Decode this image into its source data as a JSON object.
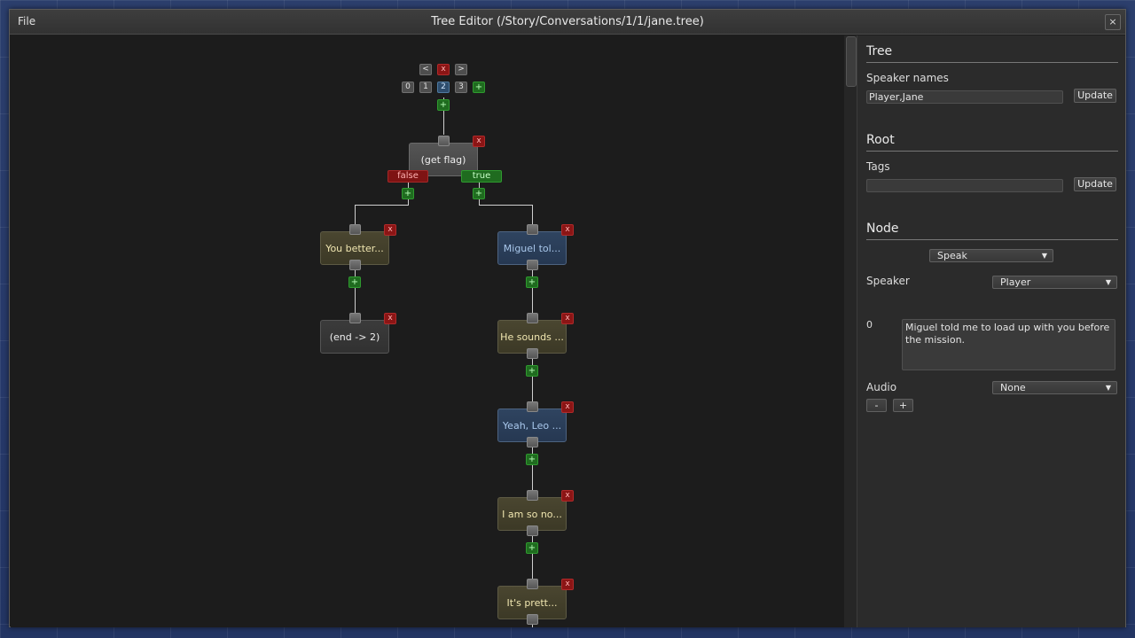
{
  "window": {
    "title": "Tree Editor (/Story/Conversations/1/1/jane.tree)",
    "menu_file": "File",
    "close_glyph": "×"
  },
  "graph": {
    "nav": {
      "prev": "<",
      "delete": "x",
      "next": ">"
    },
    "pages": [
      "0",
      "1",
      "2",
      "3"
    ],
    "selected_page": "2",
    "add_glyph": "+",
    "delete_glyph": "x",
    "branch_false": "false",
    "branch_true": "true",
    "nodes": {
      "get_flag": "(get flag)",
      "left_1": "You better...",
      "left_2": "(end -> 2)",
      "right_1": "Miguel tol...",
      "right_2": "He sounds ...",
      "right_3": "Yeah, Leo ...",
      "right_4": "I am so no...",
      "right_5": "It's prett..."
    }
  },
  "panel": {
    "tree_title": "Tree",
    "speaker_names_label": "Speaker names",
    "speaker_names_value": "Player,Jane",
    "update_label": "Update",
    "root_title": "Root",
    "tags_label": "Tags",
    "tags_value": "",
    "node_title": "Node",
    "node_type": "Speak",
    "speaker_label": "Speaker",
    "speaker_value": "Player",
    "line_index": "0",
    "line_text": "Miguel told me to load up with you before the mission.",
    "audio_label": "Audio",
    "audio_value": "None",
    "minus_label": "-",
    "plus_label": "+"
  },
  "colors": {
    "false_branch": "#7e1313",
    "true_branch": "#1f6b1f",
    "delete": "#8b1515",
    "add": "#1f6b1f",
    "node_tan": "#4a4630",
    "node_blue": "#2f4460"
  }
}
